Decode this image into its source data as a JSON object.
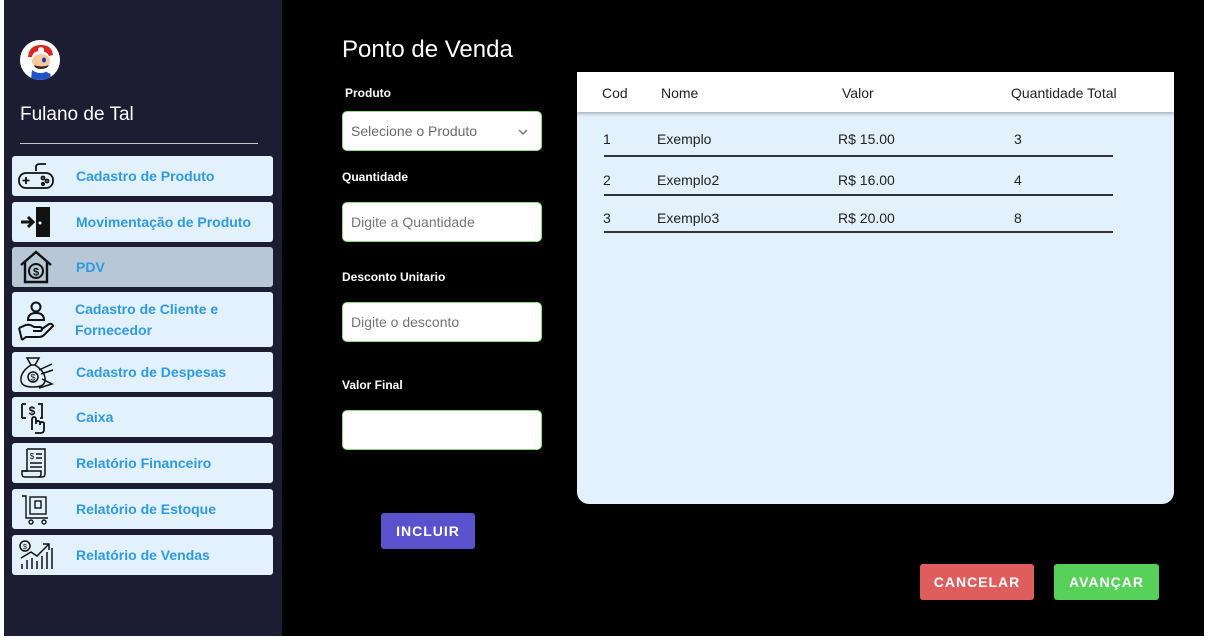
{
  "user": {
    "name": "Fulano de Tal"
  },
  "sidebar": {
    "items": [
      {
        "label": "Cadastro de Produto",
        "icon": "gamepad-icon"
      },
      {
        "label": "Movimentação de Produto",
        "icon": "enter-door-icon"
      },
      {
        "label": "PDV",
        "icon": "money-house-icon"
      },
      {
        "label": "Cadastro de Cliente e Fornecedor",
        "icon": "hand-person-icon"
      },
      {
        "label": "Cadastro de Despesas",
        "icon": "money-bag-icon"
      },
      {
        "label": "Caixa",
        "icon": "cash-hand-icon"
      },
      {
        "label": "Relatório Financeiro",
        "icon": "invoice-icon"
      },
      {
        "label": "Relatório de Estoque",
        "icon": "inventory-cart-icon"
      },
      {
        "label": "Relatório de Vendas",
        "icon": "sales-chart-icon"
      }
    ],
    "active_index": 2,
    "label_color": "#2d9ae6",
    "background": "#1c1c33"
  },
  "form": {
    "title": "Ponto de Venda",
    "produto_label": "Produto",
    "produto_placeholder": "Selecione o Produto",
    "quantidade_label": "Quantidade",
    "quantidade_placeholder": "Digite a Quantidade",
    "desconto_label": "Desconto Unitario",
    "desconto_placeholder": "Digite o desconto",
    "valor_final_label": "Valor Final",
    "valor_final_value": "",
    "incluir_label": "INCLUIR"
  },
  "table": {
    "headers": [
      "Cod",
      "Nome",
      "Valor",
      "Quantidade Total"
    ],
    "rows": [
      [
        "1",
        "Exemplo",
        "R$ 15.00",
        "3"
      ],
      [
        "2",
        "Exemplo2",
        "R$ 16.00",
        "4"
      ],
      [
        "3",
        "Exemplo3",
        "R$ 20.00",
        "8"
      ]
    ]
  },
  "actions": {
    "cancel_label": "CANCELAR",
    "advance_label": "AVANÇAR",
    "cancel_color": "#e05d5d",
    "advance_color": "#57d15a",
    "incluir_color": "#5a52cc"
  }
}
